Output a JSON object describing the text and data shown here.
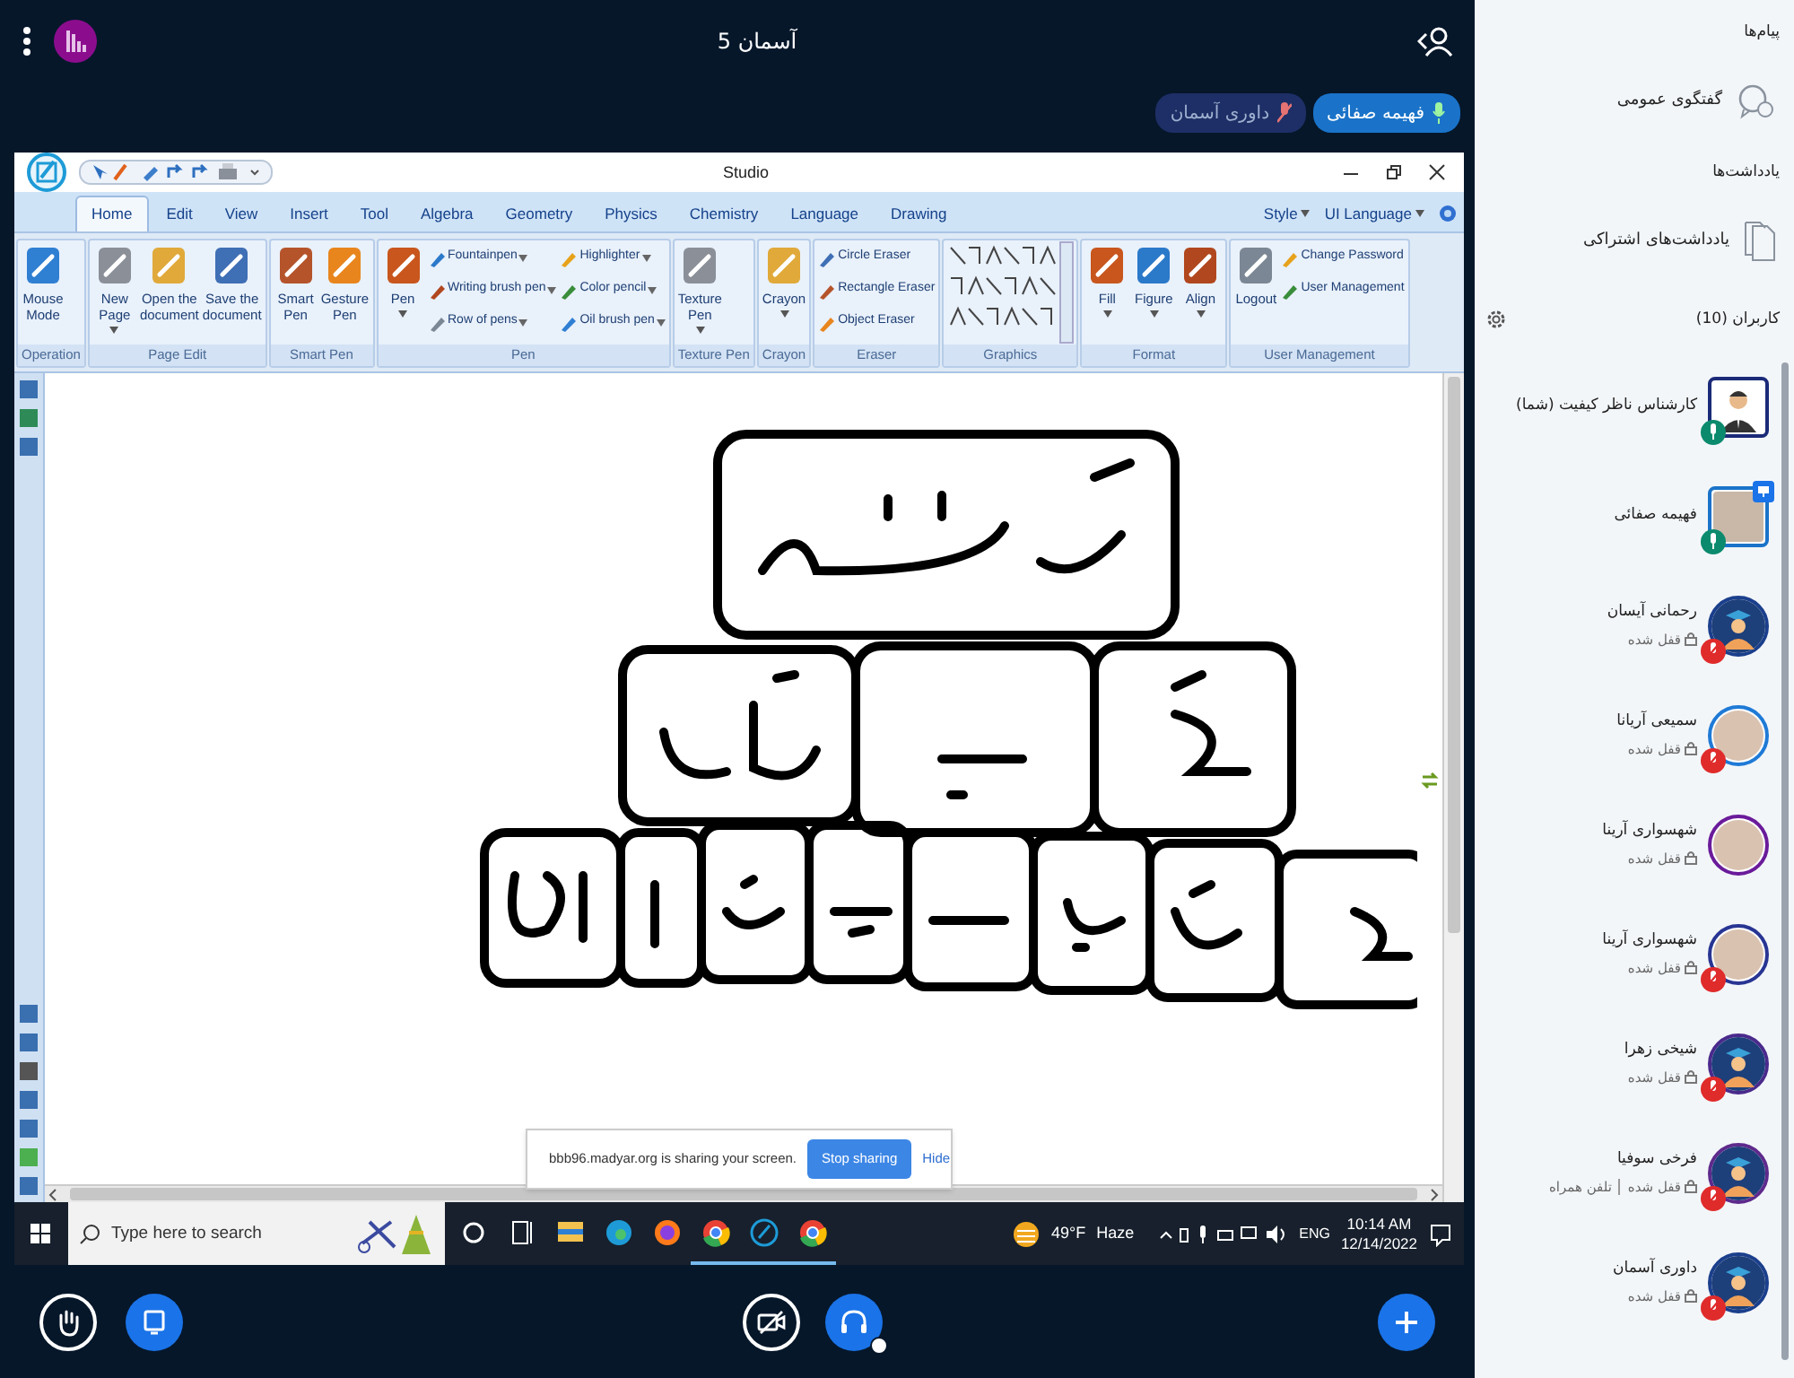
{
  "top_bar": {
    "title": "آسمان 5"
  },
  "talkers": [
    {
      "name": "فهیمه صفائی",
      "talking": true
    },
    {
      "name": "داوری آسمان",
      "talking": false
    }
  ],
  "shared_screen": {
    "window": {
      "title": "Studio"
    },
    "tabs": [
      {
        "label": "Home",
        "selected": true
      },
      {
        "label": "Edit",
        "selected": false
      },
      {
        "label": "View",
        "selected": false
      },
      {
        "label": "Insert",
        "selected": false
      },
      {
        "label": "Tool",
        "selected": false
      },
      {
        "label": "Algebra",
        "selected": false
      },
      {
        "label": "Geometry",
        "selected": false
      },
      {
        "label": "Physics",
        "selected": false
      },
      {
        "label": "Chemistry",
        "selected": false
      },
      {
        "label": "Language",
        "selected": false
      },
      {
        "label": "Drawing",
        "selected": false
      }
    ],
    "tab_menus": [
      "Style",
      "UI Language"
    ],
    "ribbon_groups": [
      {
        "label": "Operation",
        "items": [
          {
            "kind": "large",
            "label": "Mouse\nMode",
            "has_menu": false
          }
        ]
      },
      {
        "label": "Page Edit",
        "items": [
          {
            "kind": "large",
            "label": "New\nPage",
            "has_menu": true
          },
          {
            "kind": "large",
            "label": "Open the\ndocument",
            "has_menu": false
          },
          {
            "kind": "large",
            "label": "Save the\ndocument",
            "has_menu": false
          }
        ]
      },
      {
        "label": "Smart Pen",
        "items": [
          {
            "kind": "large",
            "label": "Smart\nPen",
            "has_menu": false
          },
          {
            "kind": "large",
            "label": "Gesture\nPen",
            "has_menu": false
          }
        ]
      },
      {
        "label": "Pen",
        "items": [
          {
            "kind": "large",
            "label": "Pen",
            "has_menu": true
          },
          {
            "kind": "small",
            "label": "Fountainpen",
            "has_menu": true
          },
          {
            "kind": "small",
            "label": "Writing brush pen",
            "has_menu": true
          },
          {
            "kind": "small",
            "label": "Row of pens",
            "has_menu": true
          },
          {
            "kind": "small",
            "label": "Highlighter",
            "has_menu": true
          },
          {
            "kind": "small",
            "label": "Color pencil",
            "has_menu": true
          },
          {
            "kind": "small",
            "label": "Oil brush pen",
            "has_menu": true
          }
        ]
      },
      {
        "label": "Texture Pen",
        "items": [
          {
            "kind": "large",
            "label": "Texture\nPen",
            "has_menu": true
          }
        ]
      },
      {
        "label": "Crayon",
        "items": [
          {
            "kind": "large",
            "label": "Crayon",
            "has_menu": true
          }
        ]
      },
      {
        "label": "Eraser",
        "items": [
          {
            "kind": "small",
            "label": "Circle Eraser",
            "has_menu": false
          },
          {
            "kind": "small",
            "label": "Rectangle Eraser",
            "has_menu": false
          },
          {
            "kind": "small",
            "label": "Object Eraser",
            "has_menu": false
          }
        ]
      },
      {
        "label": "Graphics",
        "items": [
          {
            "kind": "gallery"
          }
        ]
      },
      {
        "label": "Format",
        "items": [
          {
            "kind": "large",
            "label": "Fill",
            "has_menu": true
          },
          {
            "kind": "large",
            "label": "Figure",
            "has_menu": true
          },
          {
            "kind": "large",
            "label": "Align",
            "has_menu": true
          }
        ]
      },
      {
        "label": "User Management",
        "items": [
          {
            "kind": "large",
            "label": "Logout",
            "has_menu": false
          },
          {
            "kind": "small",
            "label": "Change Password",
            "has_menu": false
          },
          {
            "kind": "small",
            "label": "User Management",
            "has_menu": false
          }
        ]
      }
    ],
    "share_notice": {
      "text": "bbb96.madyar.org is sharing your screen.",
      "stop_button": "Stop sharing",
      "hide_link": "Hide"
    },
    "taskbar": {
      "search_placeholder": "Type here to search",
      "apps": [
        {
          "kind": "circle",
          "running": false
        },
        {
          "kind": "taskview",
          "running": false
        },
        {
          "kind": "folder",
          "running": false
        },
        {
          "kind": "edge",
          "running": false
        },
        {
          "kind": "firefox",
          "running": false
        },
        {
          "kind": "chrome",
          "running": true
        },
        {
          "kind": "studio",
          "running": true
        },
        {
          "kind": "chrome",
          "running": true
        }
      ],
      "temperature": "49°F",
      "weather": "Haze",
      "language": "ENG",
      "time": "10:14 AM",
      "date": "12/14/2022"
    }
  },
  "sidebar": {
    "messages_heading": "پیام‌ها",
    "public_chat": "گفتگوی عمومی",
    "notes_heading": "یادداشت‌ها",
    "shared_notes": "یادداشت‌های اشتراکی",
    "users_heading": "کاربران (10)",
    "users": [
      {
        "name": "کارشناس ناظر کیفیت (شما)",
        "kind": "person",
        "moderator": true,
        "color": "#1b2a78",
        "joined_audio": true,
        "muted": false,
        "presenter": false,
        "locked": false
      },
      {
        "name": "فهیمه صفائی",
        "kind": "photo",
        "moderator": true,
        "color": "#1a73c9",
        "joined_audio": true,
        "muted": false,
        "presenter": true,
        "locked": false
      },
      {
        "name": "رحمانی آیسان",
        "kind": "graduate",
        "moderator": false,
        "color": "#1b3f8c",
        "joined_audio": true,
        "muted": true,
        "presenter": false,
        "locked": true,
        "lock_label": "قفل شده"
      },
      {
        "name": "سمیعی آریانا",
        "kind": "photo",
        "moderator": false,
        "color": "#1f7ad6",
        "joined_audio": true,
        "muted": true,
        "presenter": false,
        "locked": true,
        "lock_label": "قفل شده"
      },
      {
        "name": "شهسواری آرینا",
        "kind": "photo",
        "moderator": false,
        "color": "#6a1b9a",
        "joined_audio": false,
        "presenter": false,
        "locked": true,
        "lock_label": "قفل شده"
      },
      {
        "name": "شهسواری آرینا",
        "kind": "photo",
        "moderator": false,
        "color": "#283593",
        "joined_audio": true,
        "muted": true,
        "presenter": false,
        "locked": true,
        "lock_label": "قفل شده"
      },
      {
        "name": "شیخی زهرا",
        "kind": "graduate",
        "moderator": false,
        "color": "#4a2a8c",
        "joined_audio": true,
        "muted": true,
        "presenter": false,
        "locked": true,
        "lock_label": "قفل شده"
      },
      {
        "name": "فرخی سوفیا",
        "kind": "graduate",
        "moderator": false,
        "color": "#5e2a8c",
        "joined_audio": true,
        "muted": true,
        "presenter": false,
        "locked": true,
        "lock_label": "قفل شده",
        "device": "تلفن همراه"
      },
      {
        "name": "داوری آسمان",
        "kind": "graduate",
        "moderator": false,
        "color": "#1b3f8c",
        "joined_audio": true,
        "muted": true,
        "presenter": false,
        "locked": true,
        "lock_label": "قفل شده"
      }
    ]
  }
}
